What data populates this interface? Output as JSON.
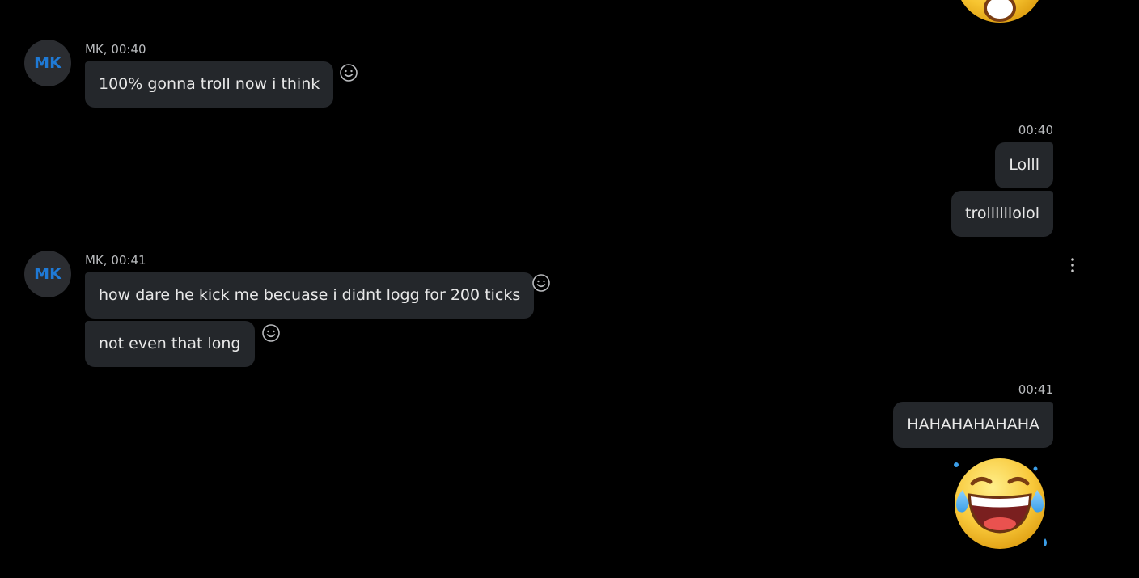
{
  "conversation": {
    "incoming": [
      {
        "avatar_initials": "MK",
        "meta": "MK, 00:40",
        "messages": [
          "100% gonna troll now i think"
        ]
      },
      {
        "avatar_initials": "MK",
        "meta": "MK, 00:41",
        "messages": [
          "how dare he kick me becuase i didnt logg for 200 ticks",
          "not even that long"
        ]
      }
    ],
    "outgoing": [
      {
        "meta": "00:40",
        "messages": [
          "Lolll",
          "trollllllolol"
        ]
      },
      {
        "meta": "00:41",
        "messages": [
          "HAHAHAHAHAHA"
        ],
        "sticker": "rolling-on-floor-laughing-emoji"
      }
    ]
  },
  "icons": {
    "reaction": "smiley-face-icon",
    "more": "vertical-ellipsis-icon",
    "top_sticker": "laughing-emoji"
  },
  "colors": {
    "background": "#000000",
    "bubble": "#24272b",
    "avatar_bg": "#2b2d31",
    "avatar_text": "#1f7ad6",
    "meta_text": "#b9bbbe",
    "message_text": "#e8e8e8"
  }
}
